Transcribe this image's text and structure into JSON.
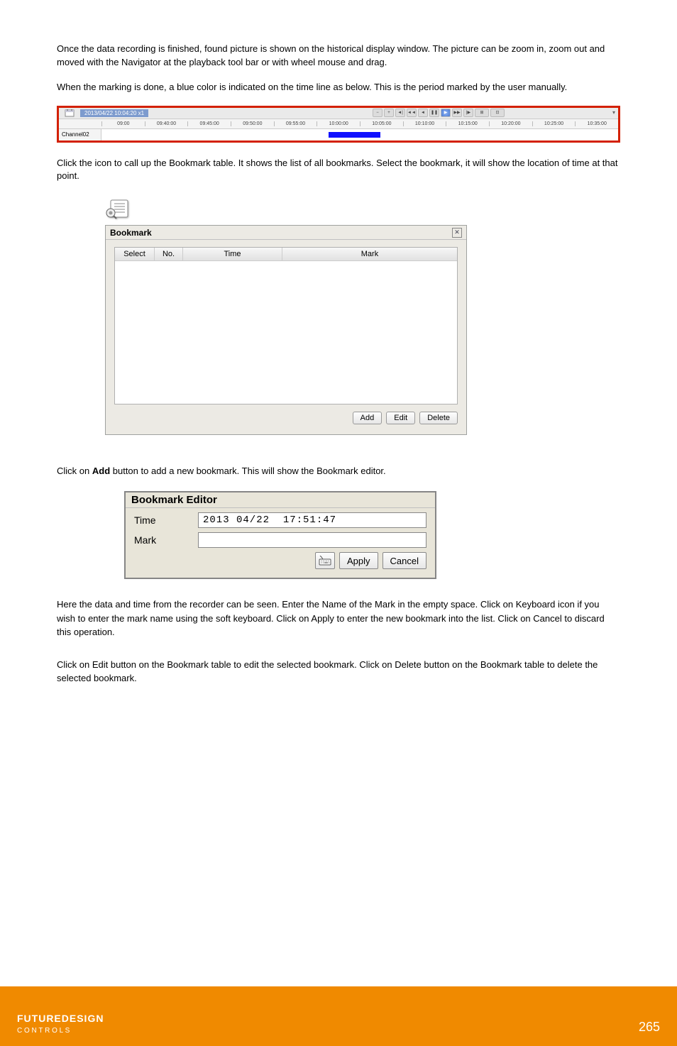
{
  "para1": "Once the data recording is finished, found picture is shown on the historical display window. The picture can be zoom in, zoom out and moved with the Navigator at the playback tool bar or with wheel mouse and drag.",
  "para2": "When the marking is done, a blue color is indicated on the time line as below. This is the period marked by the user manually.",
  "timeline": {
    "datetime": "2013/04/22 10:04:20 x1",
    "channel": "Channel02",
    "marks": [
      "09:00",
      "09:40:00",
      "09:45:00",
      "09:50:00",
      "09:55:00",
      "10:00:00",
      "10:05:00",
      "10:10:00",
      "10:15:00",
      "10:20:00",
      "10:25:00",
      "10:35:00"
    ]
  },
  "bookmark_para": "Click the icon              to call up the Bookmark table. It shows the list of all bookmarks. Select the bookmark, it will show the location of time at that point.",
  "bookmark": {
    "title": "Bookmark",
    "columns": {
      "select": "Select",
      "no": "No.",
      "time": "Time",
      "mark": "Mark"
    },
    "buttons": {
      "add": "Add",
      "edit": "Edit",
      "delete": "Delete"
    }
  },
  "editor_intro": {
    "pre": "Click on ",
    "bold": "Add",
    "post": " button to add a new bookmark. This will show the Bookmark editor."
  },
  "editor": {
    "title": "Bookmark Editor",
    "time_label": "Time",
    "mark_label": "Mark",
    "time_value": "2013 04/22  17:51:47",
    "mark_value": "",
    "apply": "Apply",
    "cancel": "Cancel"
  },
  "post1": "Here the data and time from the recorder can be seen. Enter the Name of the Mark in the empty space. Click on Keyboard icon if you wish to enter the mark name using the soft keyboard. Click on Apply to enter the new bookmark into the list. Click on Cancel to discard this operation.",
  "post2": "Click on Edit button on the Bookmark table to edit the selected bookmark. Click on Delete button on the Bookmark table to delete the selected bookmark.",
  "footer": {
    "brand": "FUTUREDESIGN",
    "tag": "C O N T R O L S",
    "page": "265"
  }
}
